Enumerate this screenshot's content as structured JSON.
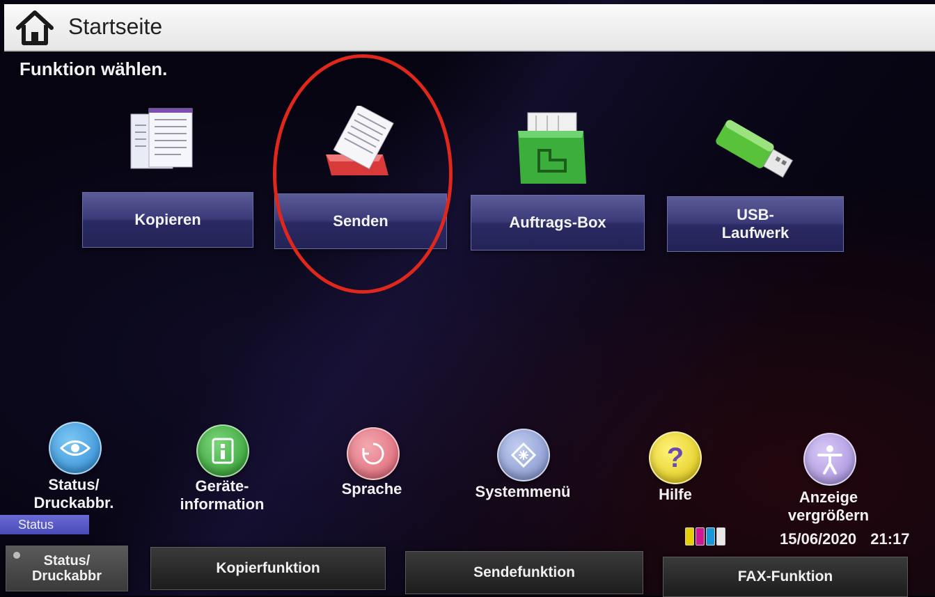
{
  "header": {
    "title": "Startseite",
    "icon": "home-icon"
  },
  "prompt": "Funktion wählen.",
  "tiles": [
    {
      "label": "Kopieren",
      "icon": "copy-documents-icon"
    },
    {
      "label": "Senden",
      "icon": "send-tray-icon"
    },
    {
      "label": "Auftrags-Box",
      "icon": "job-box-icon"
    },
    {
      "label": "USB-\nLaufwerk",
      "icon": "usb-drive-icon"
    }
  ],
  "shortcuts": [
    {
      "label": "Status/\nDruckabbr.",
      "icon": "status-eye-icon",
      "color": "#3a9be0"
    },
    {
      "label": "Geräte-\ninformation",
      "icon": "device-info-icon",
      "color": "#3aa83a"
    },
    {
      "label": "Sprache",
      "icon": "language-icon",
      "color": "#e0707a"
    },
    {
      "label": "Systemmenü",
      "icon": "system-menu-icon",
      "color": "#8a9ed8"
    },
    {
      "label": "Hilfe",
      "icon": "help-icon",
      "color": "#e6d21e"
    },
    {
      "label": "Anzeige\nvergrößern",
      "icon": "accessibility-icon",
      "color": "#b49ae0"
    }
  ],
  "status_tag": "Status",
  "date": "15/06/2020",
  "time": "21:17",
  "toner_colors": [
    "#e8d000",
    "#d01890",
    "#1898d8",
    "#222222"
  ],
  "function_bar": [
    {
      "label": "Status/\nDruckabbr"
    },
    {
      "label": "Kopierfunktion"
    },
    {
      "label": "Sendefunktion"
    },
    {
      "label": "FAX-Funktion"
    }
  ],
  "highlight_color": "#e0271c"
}
